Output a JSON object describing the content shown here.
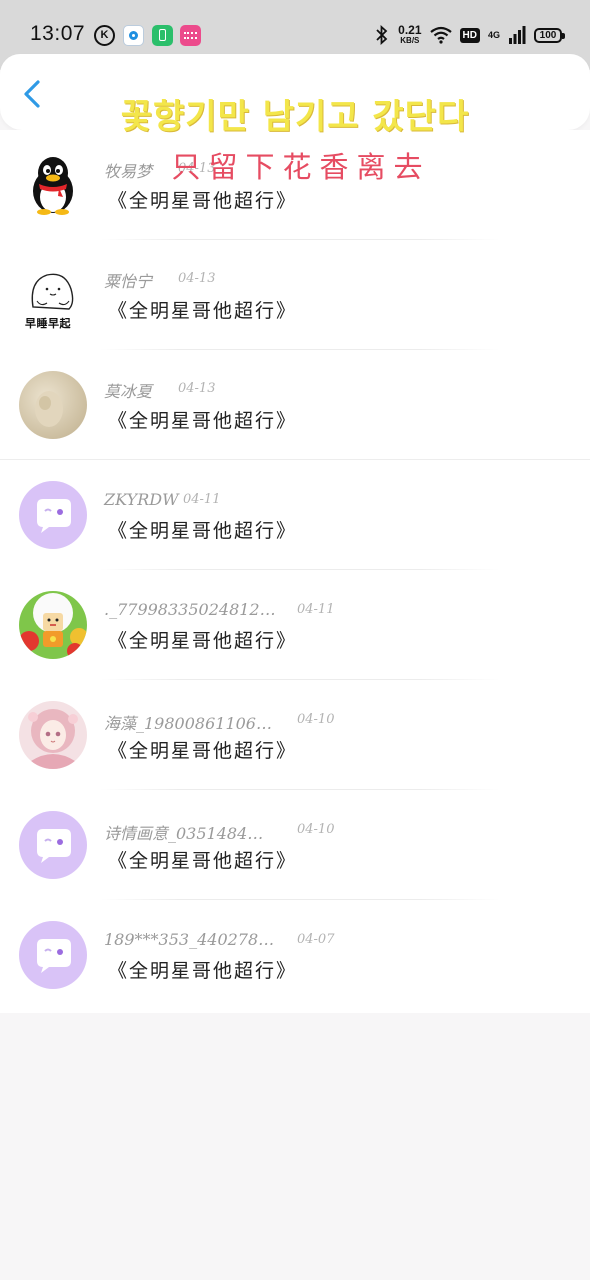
{
  "status_bar": {
    "time": "13:07",
    "net_speed_value": "0.21",
    "net_speed_unit": "KB/S",
    "hd": "HD",
    "network": "4G",
    "battery": "100"
  },
  "header": {
    "overlay_korean": "꽃향기만 남기고 갔단다",
    "overlay_chinese": "只留下花香离去"
  },
  "messages": [
    {
      "name": "牧易梦",
      "date": "04-13",
      "text": "《全明星哥他超行》",
      "avatar": "penguin-avatar"
    },
    {
      "name": "粟怡宁",
      "date": "04-13",
      "text": "《全明星哥他超行》",
      "avatar": "sketch-avatar",
      "avatar_caption": "早睡早起"
    },
    {
      "name": "莫冰夏",
      "date": "04-13",
      "text": "《全明星哥他超行》",
      "avatar": "photo-avatar"
    },
    {
      "name": "ZKYRDW",
      "date": "04-11",
      "text": "《全明星哥他超行》",
      "avatar": "chat-bubble-avatar"
    },
    {
      "name": "._77998335024812…",
      "date": "04-11",
      "text": "《全明星哥他超行》",
      "avatar": "sheep-avatar"
    },
    {
      "name": "海藻_19800861106…",
      "date": "04-10",
      "text": "《全明星哥他超行》",
      "avatar": "anime-girl-avatar"
    },
    {
      "name": "诗情画意_0351484…",
      "date": "04-10",
      "text": "《全明星哥他超行》",
      "avatar": "chat-bubble-avatar"
    },
    {
      "name": "189***353_440278…",
      "date": "04-07",
      "text": "《全明星哥他超行》",
      "avatar": "chat-bubble-avatar"
    }
  ],
  "colors": {
    "accent": "#2f9ae6",
    "bubble_avatar": "#d9c3f7",
    "overlay_yellow": "#f3e64a",
    "overlay_red": "#e64c62"
  }
}
